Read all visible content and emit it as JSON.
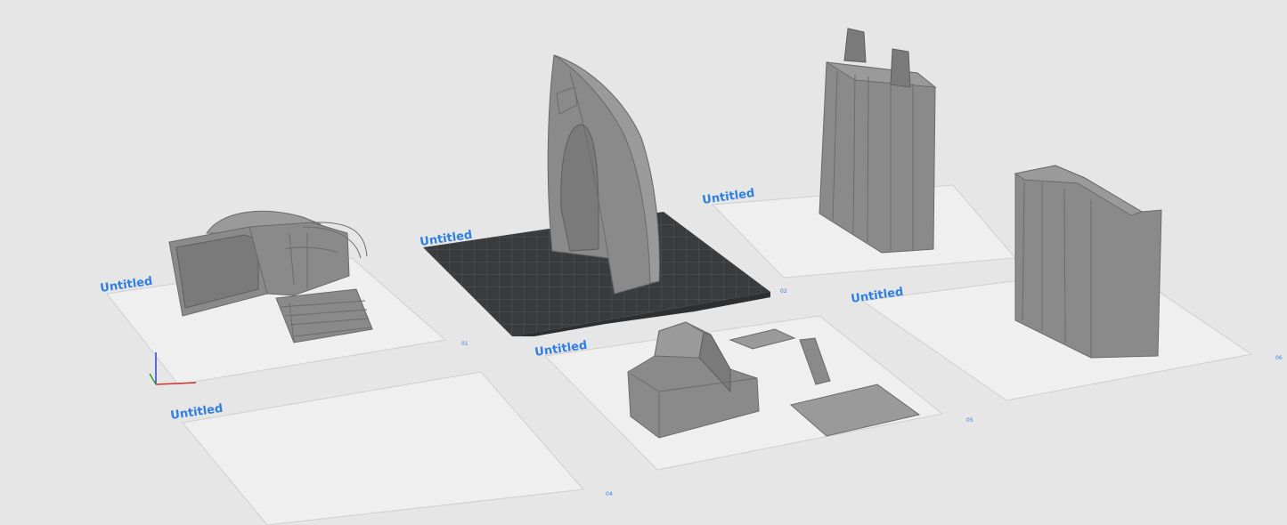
{
  "plates": [
    {
      "id": "plate-1",
      "title": "Untitled",
      "number": "01",
      "active": false
    },
    {
      "id": "plate-2",
      "title": "Untitled",
      "number": "02",
      "active": true
    },
    {
      "id": "plate-3",
      "title": "Untitled",
      "number": "03",
      "active": false
    },
    {
      "id": "plate-4",
      "title": "Untitled",
      "number": "04",
      "active": false
    },
    {
      "id": "plate-5",
      "title": "Untitled",
      "number": "05",
      "active": false
    },
    {
      "id": "plate-6",
      "title": "Untitled",
      "number": "06",
      "active": false
    }
  ],
  "colors": {
    "background": "#e6e6e6",
    "plate_title": "#2f7fe0",
    "model_gray": "#8a8a8a",
    "active_bed": "#3a3b3c",
    "axis_x": "#d03030",
    "axis_y": "#30a030",
    "axis_z": "#3040d0"
  },
  "icons": {
    "axis_gizmo": "xyz-axis-gizmo-icon"
  }
}
